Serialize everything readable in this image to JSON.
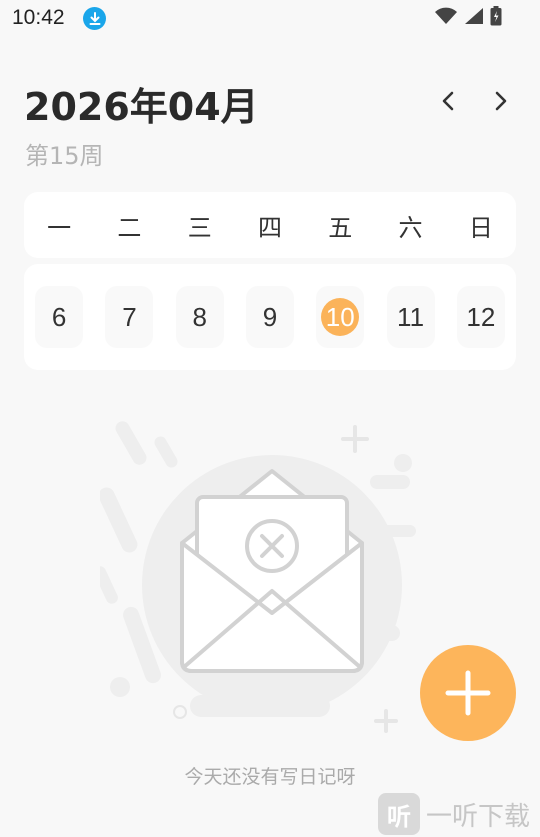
{
  "status_bar": {
    "time": "10:42",
    "icons": [
      "download-icon",
      "wifi-icon",
      "signal-icon",
      "battery-icon"
    ]
  },
  "header": {
    "month_title": "2026年04月",
    "week_label": "第15周"
  },
  "calendar": {
    "weekdays": [
      "一",
      "二",
      "三",
      "四",
      "五",
      "六",
      "日"
    ],
    "dates": [
      "6",
      "7",
      "8",
      "9",
      "10",
      "11",
      "12"
    ],
    "selected_index": 4,
    "accent_color": "#fbb35a"
  },
  "empty_state": {
    "message": "今天还没有写日记呀"
  },
  "fab": {
    "icon": "plus-icon",
    "color": "#fdb55b"
  },
  "watermark": {
    "logo_char": "听",
    "text": "一听下载"
  }
}
